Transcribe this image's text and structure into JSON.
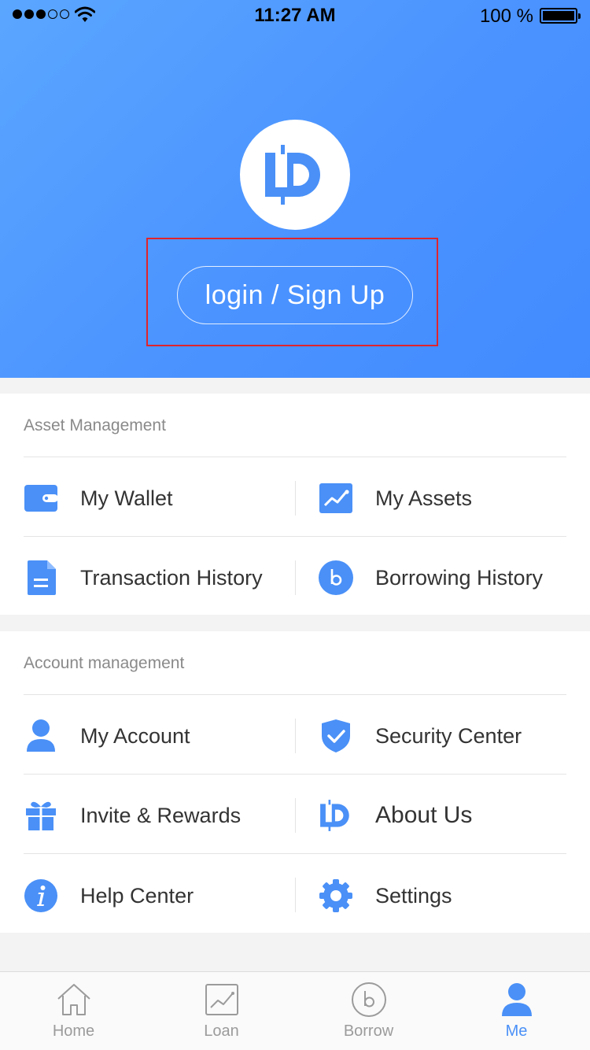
{
  "status_bar": {
    "time": "11:27 AM",
    "battery": "100 %"
  },
  "header": {
    "login_label": "login / Sign Up",
    "logo_icon": "lb-coin-logo"
  },
  "asset_section": {
    "title": "Asset Management",
    "items": [
      {
        "label": "My Wallet",
        "icon": "wallet-icon"
      },
      {
        "label": "My Assets",
        "icon": "chart-icon"
      },
      {
        "label": "Transaction History",
        "icon": "document-icon"
      },
      {
        "label": "Borrowing History",
        "icon": "b-circle-icon"
      }
    ]
  },
  "account_section": {
    "title": "Account management",
    "items": [
      {
        "label": "My Account",
        "icon": "user-icon"
      },
      {
        "label": "Security Center",
        "icon": "shield-icon"
      },
      {
        "label": "Invite & Rewards",
        "icon": "gift-icon"
      },
      {
        "label": "About Us",
        "icon": "lb-logo-icon"
      },
      {
        "label": "Help Center",
        "icon": "info-icon"
      },
      {
        "label": "Settings",
        "icon": "gear-icon"
      }
    ]
  },
  "tabbar": {
    "tabs": [
      {
        "label": "Home",
        "icon": "home-icon",
        "active": false
      },
      {
        "label": "Loan",
        "icon": "chart-icon",
        "active": false
      },
      {
        "label": "Borrow",
        "icon": "b-circle-icon",
        "active": false
      },
      {
        "label": "Me",
        "icon": "user-icon",
        "active": true
      }
    ]
  },
  "colors": {
    "accent": "#4a90f7",
    "header_start": "#5aa6ff",
    "header_end": "#418bff",
    "highlight_box": "#e0242b"
  }
}
